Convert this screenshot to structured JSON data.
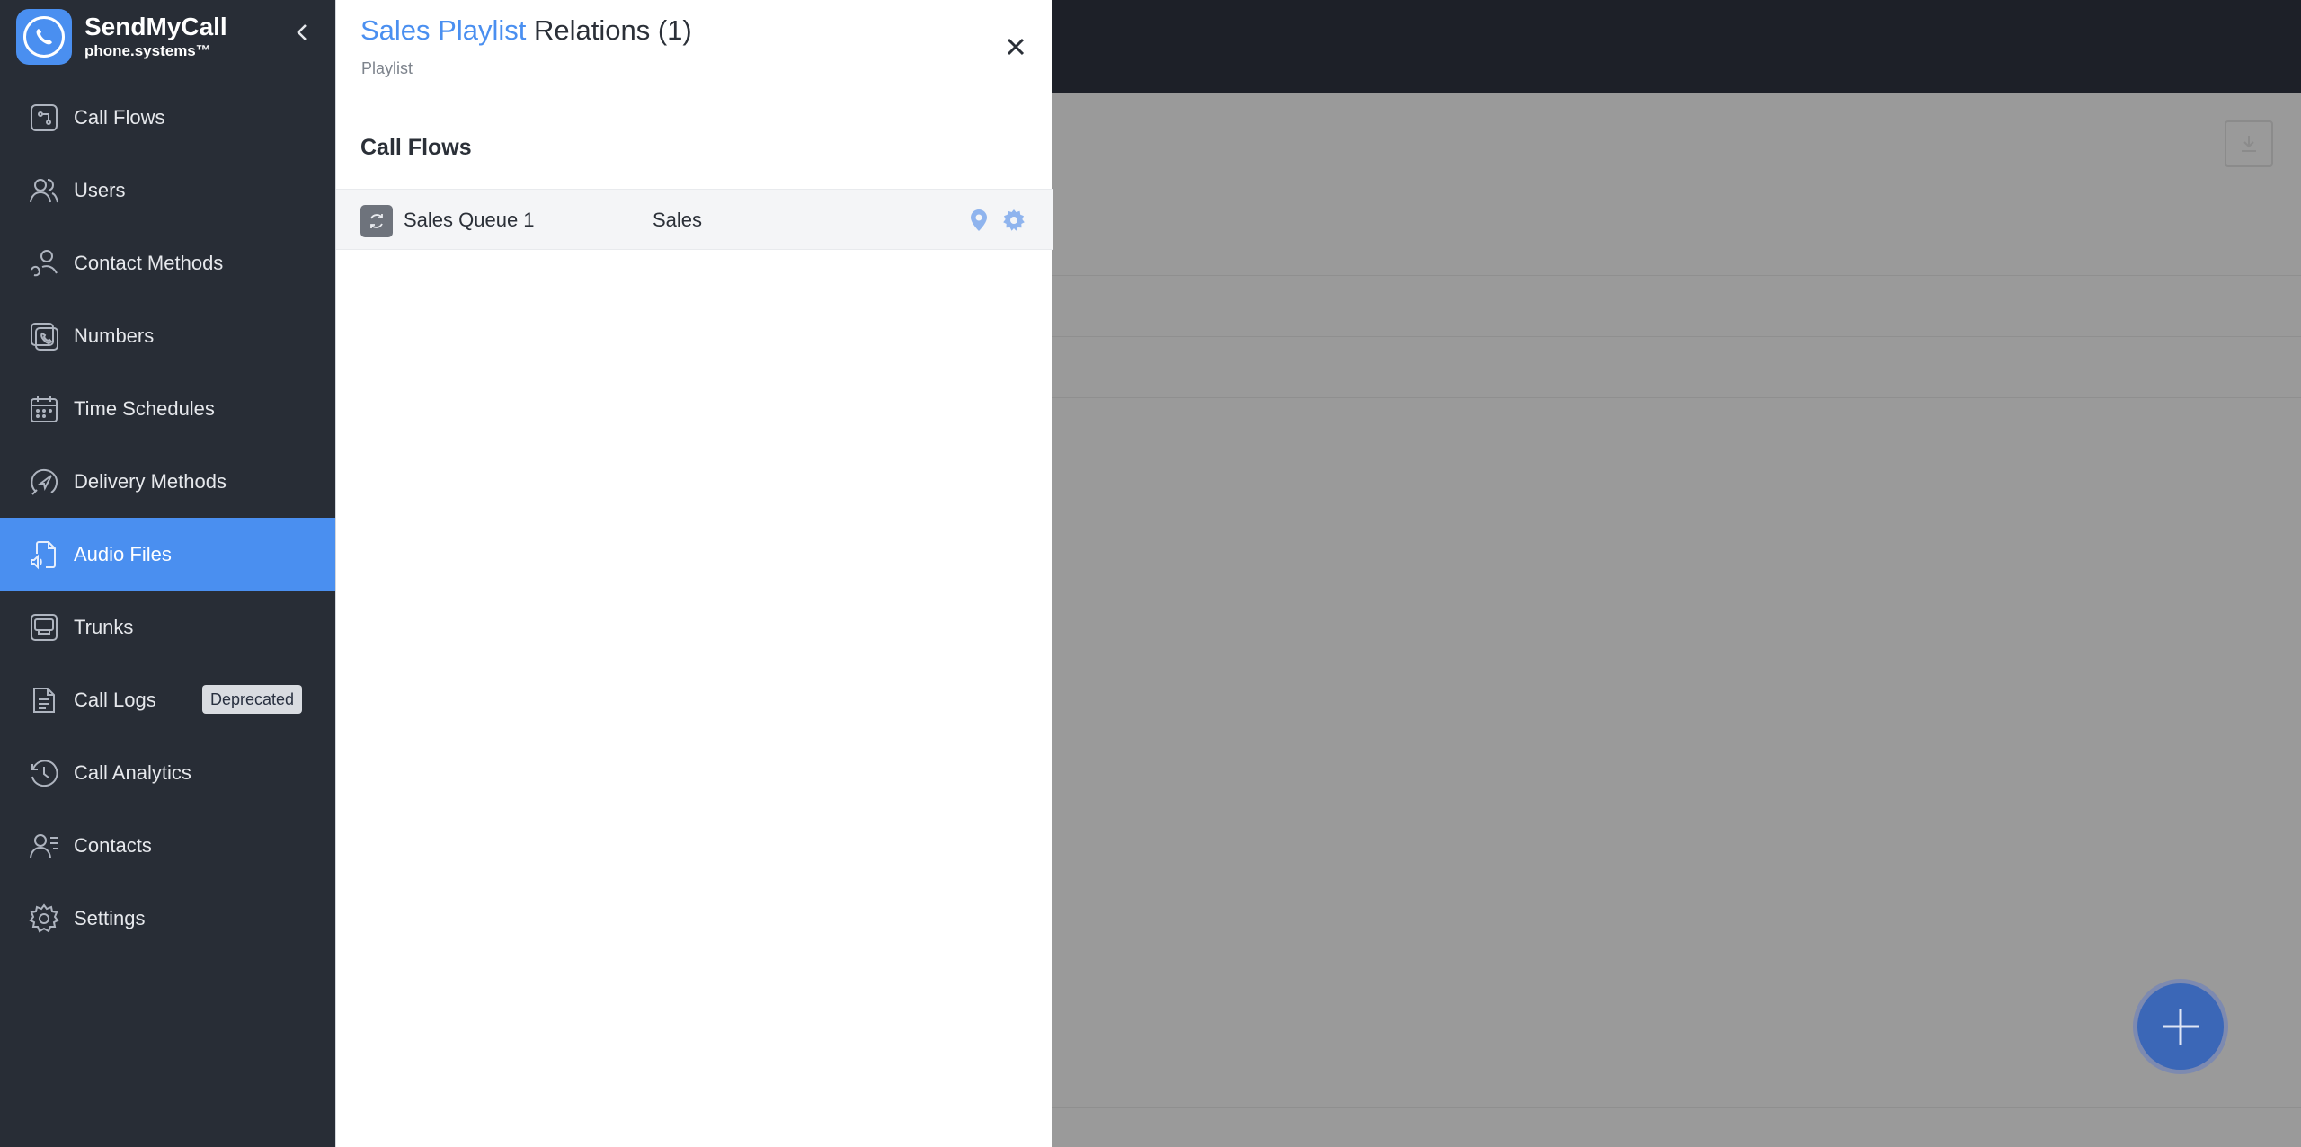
{
  "brand": {
    "name": "SendMyCall",
    "sub": "phone.systems™"
  },
  "sidebar": {
    "items": [
      {
        "label": "Call Flows",
        "icon": "call-flows-icon"
      },
      {
        "label": "Users",
        "icon": "users-icon"
      },
      {
        "label": "Contact Methods",
        "icon": "contact-methods-icon"
      },
      {
        "label": "Numbers",
        "icon": "numbers-icon"
      },
      {
        "label": "Time Schedules",
        "icon": "calendar-icon"
      },
      {
        "label": "Delivery Methods",
        "icon": "delivery-icon"
      },
      {
        "label": "Audio Files",
        "icon": "audio-file-icon",
        "active": true
      },
      {
        "label": "Trunks",
        "icon": "trunks-icon"
      },
      {
        "label": "Call Logs",
        "icon": "call-logs-icon",
        "badge": "Deprecated"
      },
      {
        "label": "Call Analytics",
        "icon": "analytics-icon"
      },
      {
        "label": "Contacts",
        "icon": "contacts-icon"
      },
      {
        "label": "Settings",
        "icon": "gear-icon"
      }
    ]
  },
  "panel": {
    "title_highlight": "Sales Playlist",
    "title_rest": " Relations (1)",
    "subtitle": "Playlist",
    "section": "Call Flows",
    "rows": [
      {
        "name": "Sales Queue 1",
        "type": "Sales"
      }
    ]
  },
  "colors": {
    "accent": "#4a8ff0",
    "sidebar": "#282d36",
    "topbar": "#1d2028",
    "fab": "#3b67b7"
  }
}
